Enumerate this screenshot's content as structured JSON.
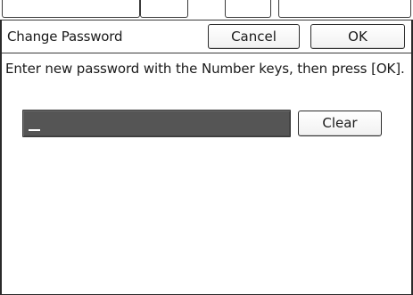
{
  "dialog": {
    "title": "Change Password",
    "cancel_label": "Cancel",
    "ok_label": "OK"
  },
  "message": "Enter new password with the Number keys, then press [OK].",
  "password_field": {
    "value": "_"
  },
  "clear_label": "Clear",
  "colors": {
    "field_background": "#555555",
    "border": "#2d2d2d",
    "background": "#ffffff"
  }
}
